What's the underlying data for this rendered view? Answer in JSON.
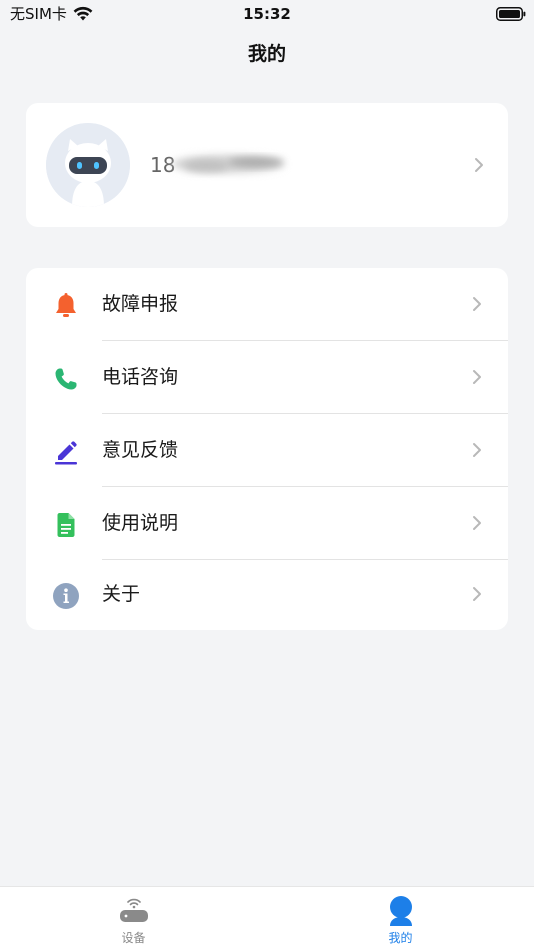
{
  "status_bar": {
    "carrier": "无SIM卡",
    "time": "15:32"
  },
  "nav": {
    "title": "我的"
  },
  "profile": {
    "phone_visible": "18"
  },
  "menu": {
    "items": [
      {
        "label": "故障申报",
        "icon": "bell-icon",
        "color": "#f4612e"
      },
      {
        "label": "电话咨询",
        "icon": "phone-icon",
        "color": "#2bb673"
      },
      {
        "label": "意见反馈",
        "icon": "edit-icon",
        "color": "#4a35d6"
      },
      {
        "label": "使用说明",
        "icon": "document-icon",
        "color": "#34c05c"
      },
      {
        "label": "关于",
        "icon": "info-icon",
        "color": "#8fa3bf"
      }
    ]
  },
  "tabs": [
    {
      "label": "设备",
      "icon": "router-icon",
      "active": false
    },
    {
      "label": "我的",
      "icon": "user-icon",
      "active": true
    }
  ],
  "colors": {
    "background": "#f3f4f6",
    "card": "#ffffff",
    "accent": "#1d7fe8",
    "inactive_tab": "#8a8a8a"
  }
}
